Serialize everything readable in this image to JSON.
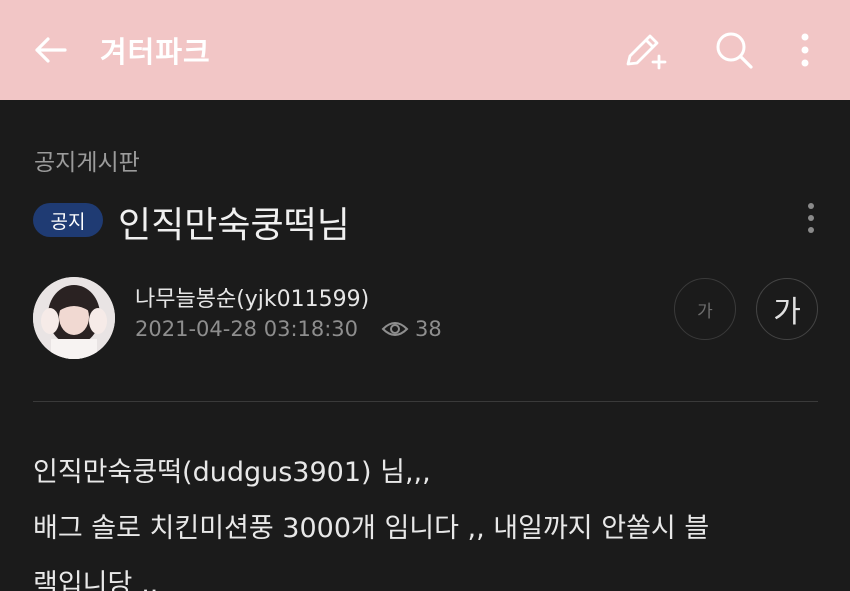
{
  "header": {
    "title": "겨터파크",
    "background_color": "#f2c6c6",
    "icons": [
      "back-arrow-icon",
      "pencil-plus-icon",
      "search-icon",
      "more-vertical-icon"
    ]
  },
  "post": {
    "board": "공지게시판",
    "badge": "공지",
    "badge_color": "#1f3b73",
    "title": "인직만숙쿵떡님",
    "author": "나무늘봉순(yjk011599)",
    "date": "2021-04-28 03:18:30",
    "views": "38",
    "font_small_label": "가",
    "font_large_label": "가",
    "content_lines": [
      "인직만숙쿵떡(dudgus3901) 님,,,",
      "배그 솔로 치킨미션풍 3000개 임니다 ,, 내일까지 안쏠시 블",
      "랙입니당 ,,"
    ]
  }
}
